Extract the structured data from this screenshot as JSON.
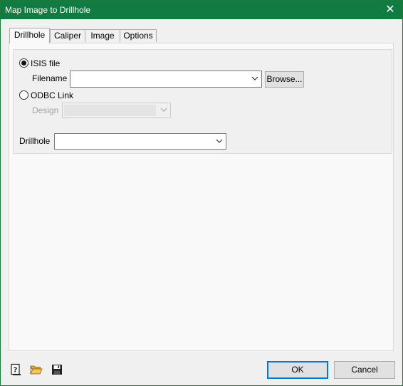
{
  "window": {
    "title": "Map Image to Drillhole",
    "close_glyph": "✕"
  },
  "tabs": [
    {
      "label": "Drillhole",
      "active": true
    },
    {
      "label": "Caliper",
      "active": false
    },
    {
      "label": "Image",
      "active": false
    },
    {
      "label": "Options",
      "active": false
    }
  ],
  "source": {
    "isis_label": "ISIS file",
    "isis_selected": true,
    "filename_label": "Filename",
    "filename_value": "",
    "browse_label": "Browse...",
    "odbc_label": "ODBC Link",
    "odbc_selected": false,
    "design_label": "Design",
    "design_value": ""
  },
  "drillhole": {
    "label": "Drillhole",
    "value": ""
  },
  "footer": {
    "ok_label": "OK",
    "cancel_label": "Cancel",
    "icons": [
      "help-icon",
      "open-folder-icon",
      "save-icon"
    ]
  },
  "colors": {
    "titlebar": "#107c41",
    "primary_border": "#0078d7"
  }
}
